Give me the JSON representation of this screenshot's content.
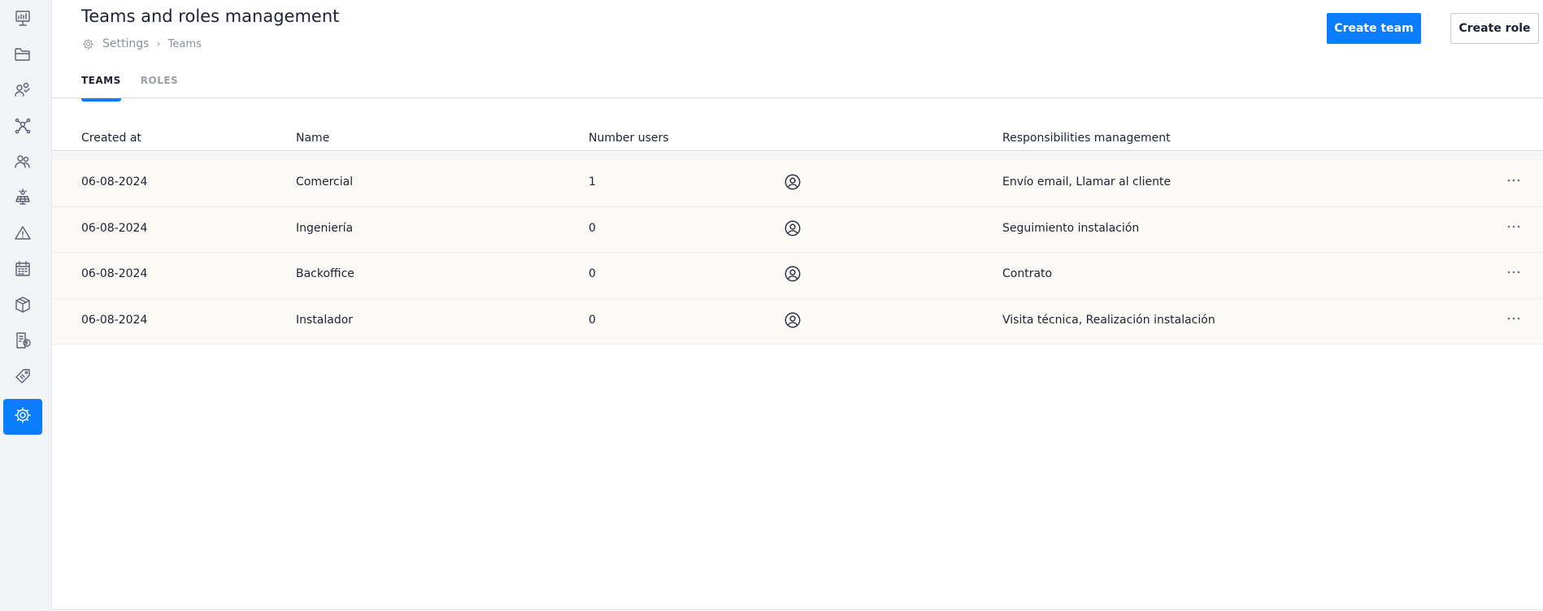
{
  "sidebar": {
    "items": [
      {
        "name": "dashboard-icon",
        "active": false
      },
      {
        "name": "folder-icon",
        "active": false
      },
      {
        "name": "leads-icon",
        "active": false
      },
      {
        "name": "network-icon",
        "active": false
      },
      {
        "name": "clients-icon",
        "active": false
      },
      {
        "name": "solar-panel-icon",
        "active": false
      },
      {
        "name": "warning-icon",
        "active": false
      },
      {
        "name": "calendar-icon",
        "active": false
      },
      {
        "name": "package-icon",
        "active": false
      },
      {
        "name": "invoice-icon",
        "active": false
      },
      {
        "name": "tag-icon",
        "active": false
      },
      {
        "name": "settings-icon",
        "active": true
      }
    ]
  },
  "header": {
    "title": "Teams and roles management",
    "breadcrumb": {
      "icon": "settings-icon",
      "parent": "Settings",
      "separator": "›",
      "current": "Teams"
    },
    "create_team_label": "Create team",
    "create_role_label": "Create role"
  },
  "tabs": [
    {
      "label": "TEAMS",
      "active": true
    },
    {
      "label": "ROLES",
      "active": false
    }
  ],
  "table": {
    "columns": {
      "created_at": "Created at",
      "name": "Name",
      "number_users": "Number users",
      "responsibilities": "Responsibilities management"
    },
    "rows": [
      {
        "created_at": "06-08-2024",
        "name": "Comercial",
        "number_users": "1",
        "responsibilities": "Envío email, Llamar al cliente"
      },
      {
        "created_at": "06-08-2024",
        "name": "Ingeniería",
        "number_users": "0",
        "responsibilities": "Seguimiento instalación"
      },
      {
        "created_at": "06-08-2024",
        "name": "Backoffice",
        "number_users": "0",
        "responsibilities": "Contrato"
      },
      {
        "created_at": "06-08-2024",
        "name": "Instalador",
        "number_users": "0",
        "responsibilities": "Visita técnica, Realización instalación"
      }
    ]
  },
  "colors": {
    "accent": "#0a7cff",
    "row_background": "#fbfaf6",
    "sidebar_background": "#f3f4f6"
  }
}
